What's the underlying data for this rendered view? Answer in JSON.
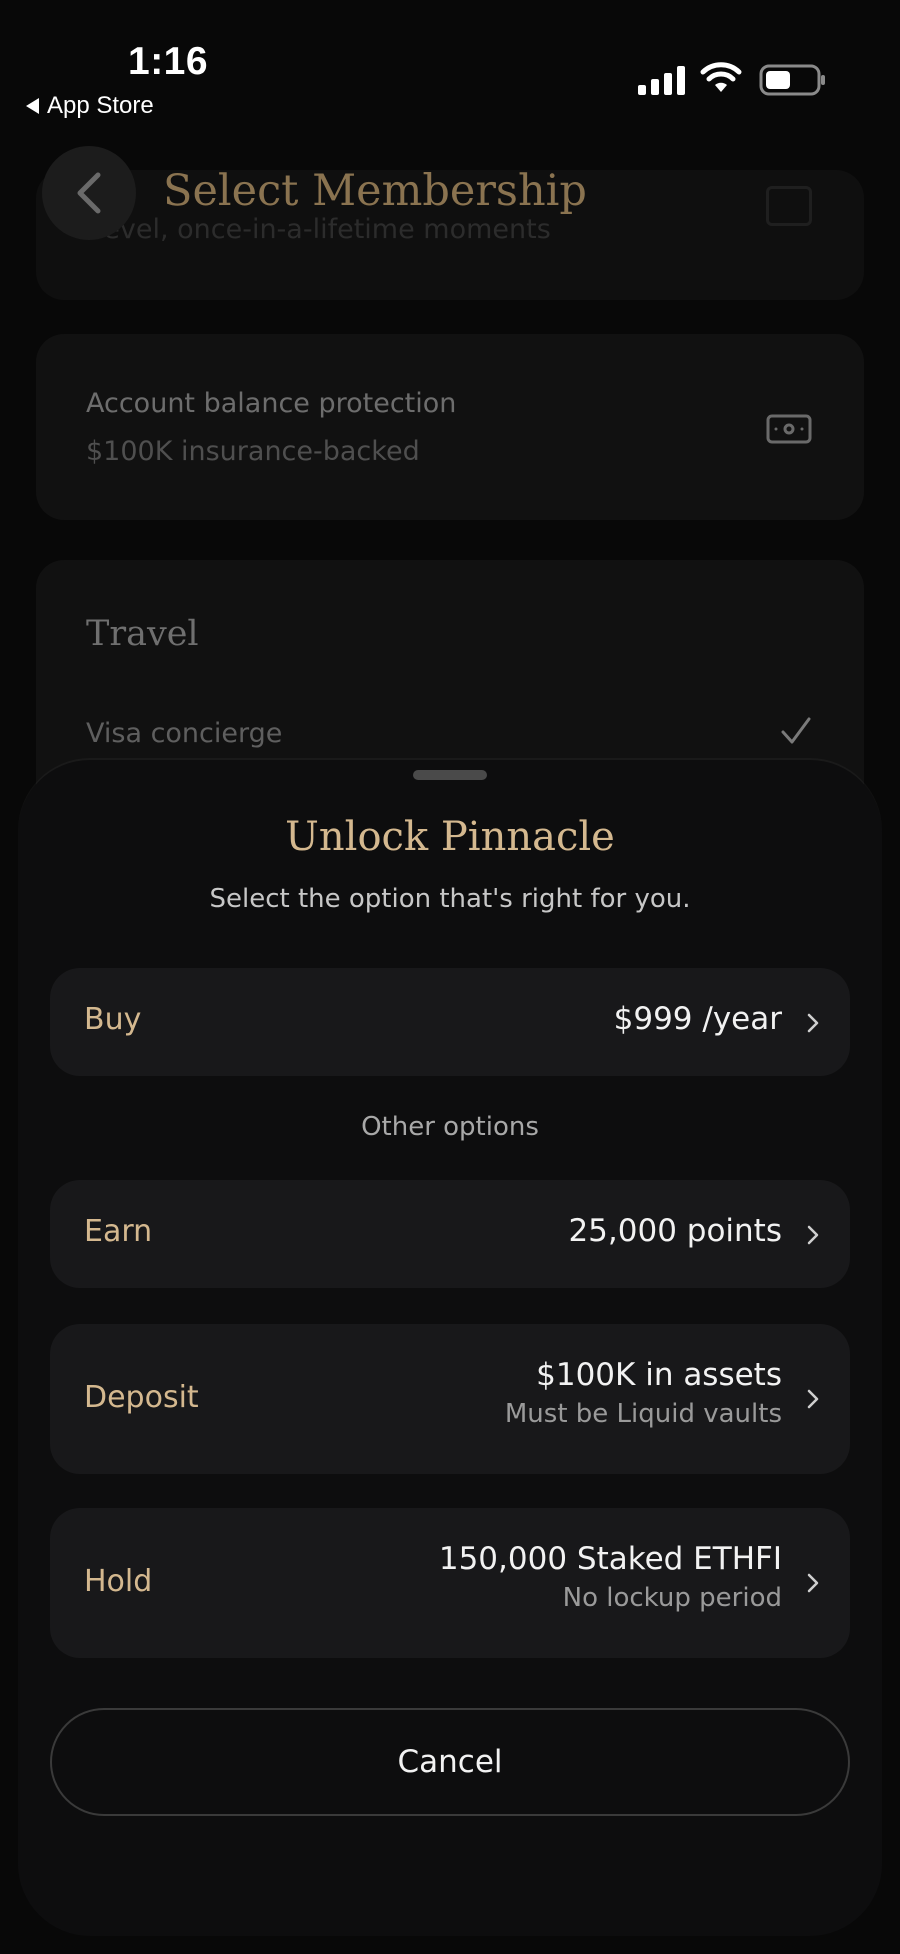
{
  "status_bar": {
    "time": "1:16",
    "back_app": "App Store"
  },
  "background": {
    "header_title": "Select Membership",
    "faded_line": "-level, once-in-a-lifetime moments",
    "protection": {
      "title": "Account balance protection",
      "subtitle": "$100K insurance-backed"
    },
    "travel": {
      "section_title": "Travel",
      "item": "Visa concierge"
    }
  },
  "sheet": {
    "title": "Unlock Pinnacle",
    "subtitle": "Select the option that's right for you.",
    "buy": {
      "label": "Buy",
      "value": "$999 /year"
    },
    "other_options_label": "Other options",
    "earn": {
      "label": "Earn",
      "value": "25,000 points"
    },
    "deposit": {
      "label": "Deposit",
      "value": "$100K in assets",
      "note": "Must be Liquid vaults"
    },
    "hold": {
      "label": "Hold",
      "value": "150,000 Staked ETHFI",
      "note": "No lockup period"
    },
    "cancel_label": "Cancel"
  },
  "colors": {
    "accent_gold": "#d4b88f",
    "sheet_bg": "#0d0d0e",
    "option_bg": "#18181a"
  }
}
